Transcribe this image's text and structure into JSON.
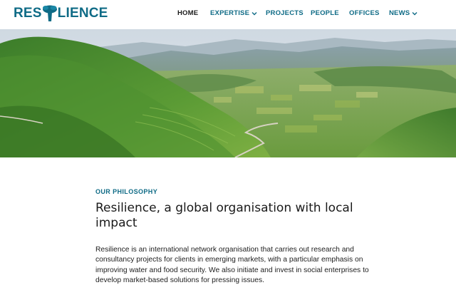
{
  "brand": {
    "logo_text_before": "RES",
    "logo_text_after": "LIENCE",
    "logo_icon": "baobab-tree-icon",
    "accent_color": "#0f6b86"
  },
  "nav": {
    "home": "HOME",
    "expertise": "EXPERTISE",
    "projects": "PROJECTS",
    "people": "PEOPLE",
    "offices": "OFFICES",
    "news": "NEWS",
    "dropdown_icon": "chevron-down-icon"
  },
  "hero": {
    "image": "green terraced mountain valley landscape"
  },
  "section": {
    "kicker": "OUR PHILOSOPHY",
    "title": "Resilience, a global organisation with local impact",
    "body": "Resilience is an international network organisation that carries out research and consultancy projects for clients in emerging markets, with a particular emphasis on improving water and food security. We also initiate and invest in social enterprises to develop market-based solutions for pressing issues."
  }
}
